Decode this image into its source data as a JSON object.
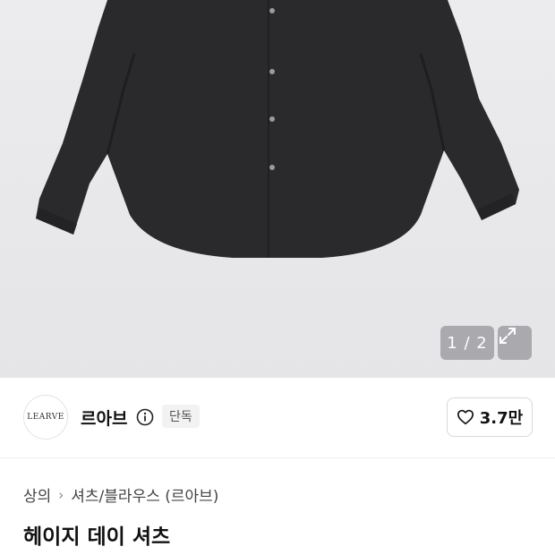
{
  "gallery": {
    "pager": "1 / 2",
    "image_alt": "black shirt product photo"
  },
  "seller": {
    "logo_text": "LEARVE",
    "name": "르아브",
    "badge": "단독"
  },
  "like": {
    "count": "3.7만"
  },
  "breadcrumb": {
    "category": "상의",
    "subcategory": "셔츠/블라우스 (르아브)"
  },
  "product": {
    "title": "헤이지 데이 셔츠"
  },
  "colors": {
    "shirt": "#2b2b2e",
    "background": "#e8e8ea"
  }
}
